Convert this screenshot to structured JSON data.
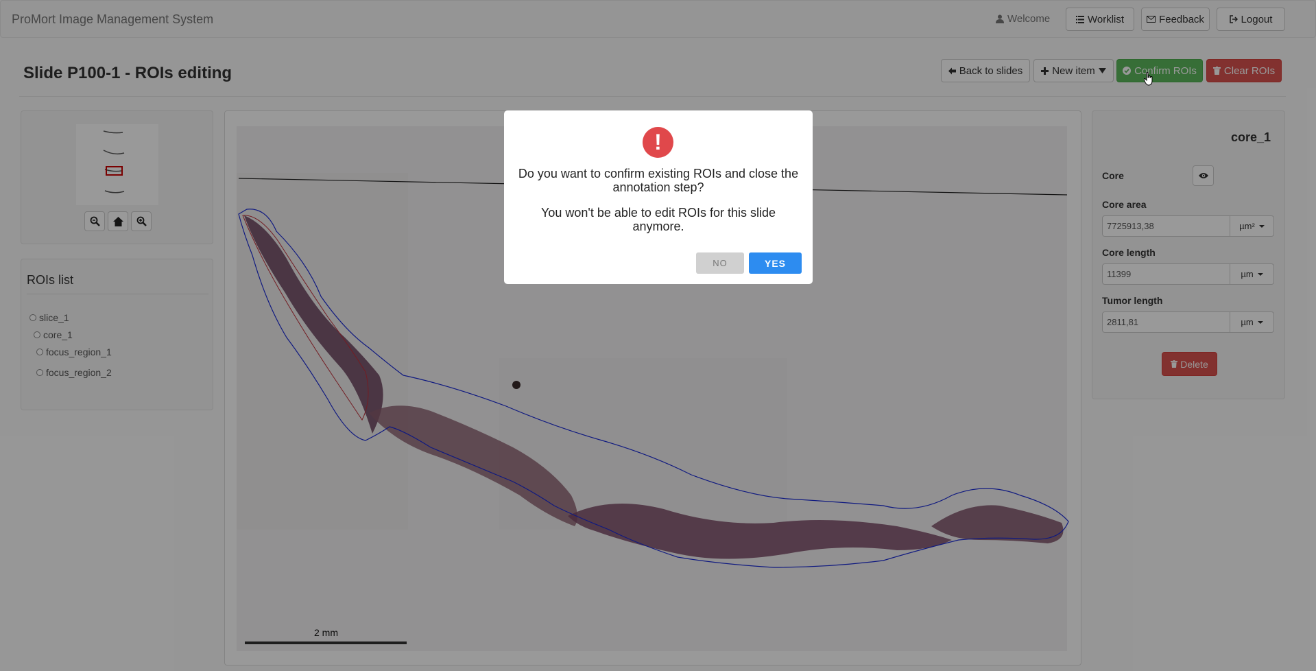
{
  "navbar": {
    "brand": "ProMort Image Management System",
    "welcome": "Welcome",
    "worklist": "Worklist",
    "feedback": "Feedback",
    "logout": "Logout"
  },
  "header": {
    "title": "Slide P100-1 - ROIs editing",
    "back_to_slides": "Back to slides",
    "new_item": "New item",
    "confirm_rois": "Confirm ROIs",
    "clear_rois": "Clear ROIs"
  },
  "rois": {
    "title": "ROIs list",
    "items": [
      {
        "label": "slice_1"
      },
      {
        "label": "core_1"
      },
      {
        "label": "focus_region_1"
      },
      {
        "label": "focus_region_2"
      }
    ]
  },
  "viewer": {
    "scale_label": "2 mm"
  },
  "details": {
    "title": "core_1",
    "core_label": "Core",
    "core_area_label": "Core area",
    "core_area_value": "7725913,38",
    "core_area_unit": "µm²",
    "core_length_label": "Core length",
    "core_length_value": "11399",
    "core_length_unit": "µm",
    "tumor_length_label": "Tumor length",
    "tumor_length_value": "2811,81",
    "tumor_length_unit": "µm",
    "delete": "Delete"
  },
  "modal": {
    "icon": "!",
    "question": "Do you want to confirm existing ROIs and close the annotation step?",
    "warning": "You won't be able to edit ROIs for this slide anymore.",
    "no": "NO",
    "yes": "YES"
  },
  "colors": {
    "success": "#5cb85c",
    "danger": "#d9534f",
    "primary": "#2d8cf0",
    "alert": "#e0484b"
  }
}
